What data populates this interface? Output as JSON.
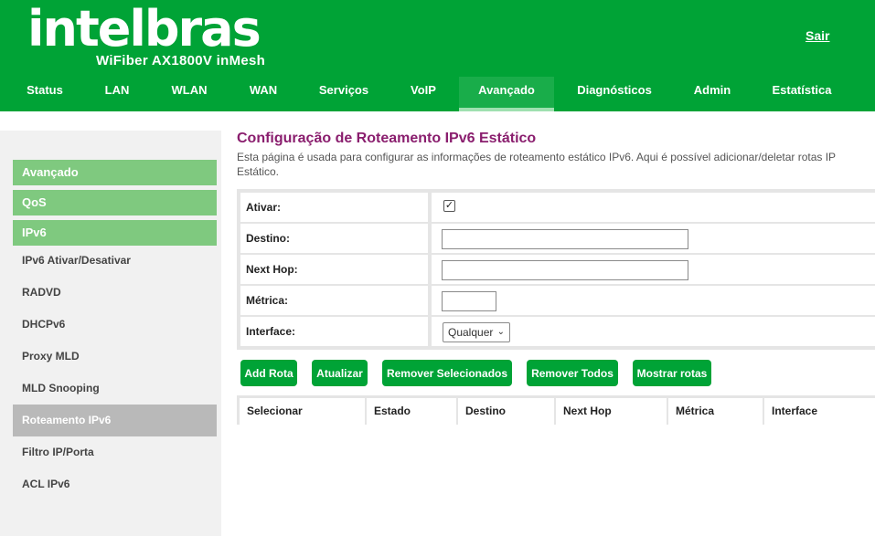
{
  "header": {
    "logo": "intelbras",
    "model": "WiFiber AX1800V inMesh",
    "logout_label": "Sair"
  },
  "topnav": {
    "tabs": [
      {
        "label": "Status"
      },
      {
        "label": "LAN"
      },
      {
        "label": "WLAN"
      },
      {
        "label": "WAN"
      },
      {
        "label": "Serviços"
      },
      {
        "label": "VoIP"
      },
      {
        "label": "Avançado"
      },
      {
        "label": "Diagnósticos"
      },
      {
        "label": "Admin"
      },
      {
        "label": "Estatística"
      }
    ],
    "active": "Avançado"
  },
  "sidebar": {
    "sections": [
      {
        "label": "Avançado"
      },
      {
        "label": "QoS"
      },
      {
        "label": "IPv6"
      }
    ],
    "items": [
      {
        "label": "IPv6 Ativar/Desativar"
      },
      {
        "label": "RADVD"
      },
      {
        "label": "DHCPv6"
      },
      {
        "label": "Proxy MLD"
      },
      {
        "label": "MLD Snooping"
      },
      {
        "label": "Roteamento IPv6"
      },
      {
        "label": "Filtro IP/Porta"
      },
      {
        "label": "ACL IPv6"
      }
    ],
    "active": "Roteamento IPv6"
  },
  "page": {
    "title": "Configuração de Roteamento IPv6 Estático",
    "description": "Esta página é usada para configurar as informações de roteamento estático IPv6. Aqui é possível adicionar/deletar rotas IP Estático."
  },
  "form": {
    "ativar_label": "Ativar:",
    "ativar_checked": true,
    "ativar_check_glyph": "✓",
    "destino_label": "Destino:",
    "destino_value": "",
    "nexthop_label": "Next Hop:",
    "nexthop_value": "",
    "metrica_label": "Métrica:",
    "metrica_value": "",
    "interface_label": "Interface:",
    "interface_selected": "Qualquer"
  },
  "buttons": {
    "add": "Add Rota",
    "update": "Atualizar",
    "remove_selected": "Remover Selecionados",
    "remove_all": "Remover Todos",
    "show_routes": "Mostrar rotas"
  },
  "table": {
    "columns": [
      "Selecionar",
      "Estado",
      "Destino",
      "Next Hop",
      "Métrica",
      "Interface"
    ]
  },
  "colors": {
    "brand_green": "#00a336",
    "sidebar_green": "#7fc97f",
    "title_purple": "#8a1e6e"
  }
}
